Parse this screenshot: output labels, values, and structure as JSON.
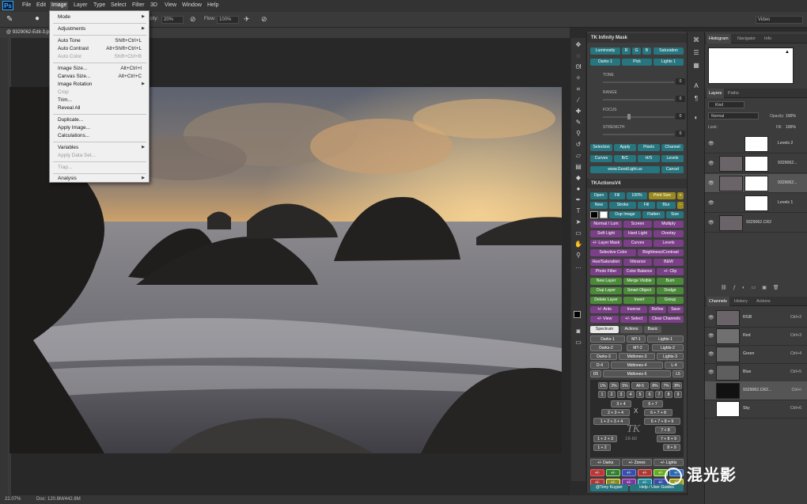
{
  "menubar": {
    "app_icon": "Ps",
    "items": [
      "File",
      "Edit",
      "Image",
      "Layer",
      "Type",
      "Select",
      "Filter",
      "3D",
      "View",
      "Window",
      "Help"
    ],
    "active": "Image"
  },
  "options_bar": {
    "opacity_label": "Opacity:",
    "opacity_value": "20%",
    "flow_label": "Flow:",
    "flow_value": "100%",
    "workspace": "Video"
  },
  "document_tab": "@ 9329062-Edit-3.psd @ 22.1%",
  "image_menu": {
    "items": [
      {
        "label": "Mode",
        "arrow": true
      },
      {
        "label": "Adjustments",
        "arrow": true
      },
      {
        "label": "Auto Tone",
        "shortcut": "Shift+Ctrl+L"
      },
      {
        "label": "Auto Contrast",
        "shortcut": "Alt+Shift+Ctrl+L"
      },
      {
        "label": "Auto Color",
        "shortcut": "Shift+Ctrl+B",
        "disabled": true
      },
      {
        "label": "Image Size...",
        "shortcut": "Alt+Ctrl+I"
      },
      {
        "label": "Canvas Size...",
        "shortcut": "Alt+Ctrl+C"
      },
      {
        "label": "Image Rotation",
        "arrow": true
      },
      {
        "label": "Crop",
        "disabled": true
      },
      {
        "label": "Trim..."
      },
      {
        "label": "Reveal All"
      },
      {
        "label": "Duplicate..."
      },
      {
        "label": "Apply Image..."
      },
      {
        "label": "Calculations..."
      },
      {
        "label": "Variables",
        "arrow": true
      },
      {
        "label": "Apply Data Set...",
        "disabled": true
      },
      {
        "label": "Trap...",
        "disabled": true
      },
      {
        "label": "Analysis",
        "arrow": true
      }
    ]
  },
  "status_bar": {
    "zoom": "22.07%",
    "doc": "Doc: 120.8M/442.8M"
  },
  "tk_panel": {
    "title": "TK Infinity Mask",
    "top_row": [
      "Luminosity",
      "R",
      "G",
      "B",
      "Saturation"
    ],
    "second_row": [
      "Darks 1",
      "Pick",
      "Lights 1"
    ],
    "sliders": [
      {
        "label": "TONE",
        "value": "0"
      },
      {
        "label": "RANGE",
        "value": "0"
      },
      {
        "label": "FOCUS",
        "value": "0"
      },
      {
        "label": "STRENGTH",
        "value": "0"
      }
    ],
    "mask_actions_1": [
      "Selection",
      "Apply",
      "Pixels",
      "Channel"
    ],
    "mask_actions_2": [
      "Curves",
      "B/C",
      "H/S",
      "Levels"
    ],
    "mask_actions_3": [
      "www.GoodLight.us",
      "Cancel"
    ],
    "actions_title": "TKActionsV4",
    "ar_row1": [
      "Open",
      "Fill",
      "100%",
      "Print Size",
      "+"
    ],
    "ar_row2": [
      "New",
      "Stroke",
      "Fill",
      "Blur",
      "-"
    ],
    "ar_row3": [
      "Dup Image",
      "Flatten",
      "Size"
    ],
    "ar_row4": [
      "Normal / Lum",
      "Screen",
      "Multiply"
    ],
    "ar_row5": [
      "Soft Light",
      "Hard Light",
      "Overlay"
    ],
    "ar_row6": [
      "+/- Layer Mask",
      "Curves",
      "Levels"
    ],
    "ar_row7": [
      "Selective Color",
      "Brightness/Contrast"
    ],
    "ar_row8": [
      "Hue/Saturation",
      "Vibrance",
      "B&W"
    ],
    "ar_row9": [
      "Photo Filter",
      "Color Balance",
      "+/- Clip"
    ],
    "ar_row10": [
      "New Layer",
      "Merge Visible",
      "Burn"
    ],
    "ar_row11": [
      "Dup Layer",
      "Smart Object",
      "Dodge"
    ],
    "ar_row12": [
      "Delete Layer",
      "Invert",
      "Group"
    ],
    "ar_row13": [
      "+/- Ants",
      "Inverse",
      "Refine",
      "Save"
    ],
    "ar_row14": [
      "+/- View",
      "+/- Select",
      "Clear Channels"
    ],
    "tabs": [
      "Spectrum",
      "Actions",
      "Basic"
    ],
    "sp_row1": [
      "Darks-1",
      "MT-1",
      "Lights-1"
    ],
    "sp_row2": [
      "Darks-2",
      "MT-2",
      "Lights-2"
    ],
    "sp_row3": [
      "Darks-3",
      "Midtones-3",
      "Lights-3"
    ],
    "sp_row4": [
      "D-4",
      "Midtones-4",
      "L-4"
    ],
    "sp_row5": [
      "D5",
      "Midtones-5",
      "L5"
    ],
    "pct_row": [
      "1%",
      "2%",
      "5%",
      "All-5",
      "8%",
      "7%",
      "8%"
    ],
    "num_row": [
      "1",
      "2",
      "3",
      "4",
      "5",
      "6",
      "7",
      "8",
      "9"
    ],
    "zone_labels": [
      "3 + 4",
      "6 + 7",
      "2 + 3 + 4",
      "6 + 7 + 8",
      "1 + 2 + 3 + 4",
      "6 + 7 + 8 + 9",
      "7 + 8",
      "1 + 2 + 3",
      "7 + 8 + 9",
      "1 + 2",
      "8 + 9"
    ],
    "x_label": "X",
    "tk_logo": "TK",
    "bit_label": "16-bit",
    "bottom_row": [
      "+/- Darks",
      "+/- Zones",
      "+/- Lights"
    ],
    "color_row1": [
      "+/-",
      "+/-",
      "+/-",
      "+/-",
      "+/-",
      "+/-"
    ],
    "color_row2": [
      "+/-",
      "+/-",
      "+/-",
      "+/-",
      "+/-",
      "+/-"
    ],
    "footer": [
      "@Tony Kuyper",
      "Help / User Guides"
    ]
  },
  "histogram_panel": {
    "tabs": [
      "Histogram",
      "Navigator",
      "Info"
    ]
  },
  "layers_panel": {
    "tabs": [
      "Layers",
      "Paths"
    ],
    "kind": "Kind",
    "blend_mode": "Normal",
    "opacity_label": "Opacity:",
    "opacity_value": "100%",
    "lock_label": "Lock:",
    "fill_label": "Fill:",
    "fill_value": "100%",
    "layers": [
      {
        "name": "Levels 2",
        "selected": false
      },
      {
        "name": "9329062...",
        "selected": false
      },
      {
        "name": "9329062...",
        "selected": true
      },
      {
        "name": "Levels 1",
        "selected": false
      },
      {
        "name": "9329062.CR2",
        "selected": false
      }
    ]
  },
  "channels_panel": {
    "tabs": [
      "Channels",
      "History",
      "Actions"
    ],
    "channels": [
      {
        "name": "RGB",
        "shortcut": "Ctrl+2"
      },
      {
        "name": "Red",
        "shortcut": "Ctrl+3"
      },
      {
        "name": "Green",
        "shortcut": "Ctrl+4"
      },
      {
        "name": "Blue",
        "shortcut": "Ctrl+5"
      },
      {
        "name": "9329062.CR2...",
        "shortcut": "Ctrl+\\"
      },
      {
        "name": "Sky",
        "shortcut": "Ctrl+6"
      }
    ]
  },
  "watermark": "混光影",
  "colors": {
    "teal": "#26757f",
    "purple": "#7a3f86",
    "green": "#4c8a3a",
    "yellow": "#9b8a1e"
  }
}
